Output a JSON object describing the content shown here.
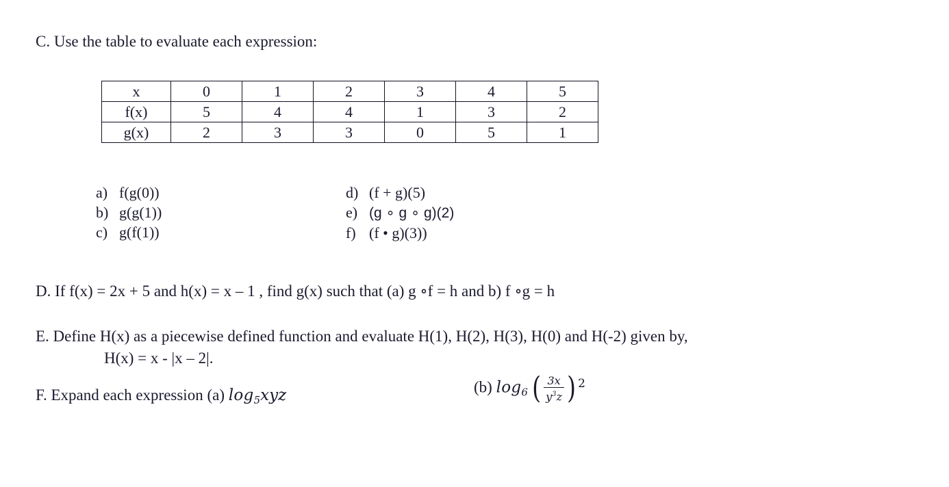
{
  "document": {
    "section_c": {
      "heading": "C. Use the table to evaluate each expression:",
      "table": {
        "row_headers": [
          "x",
          "f(x)",
          "g(x)"
        ],
        "rows": [
          {
            "label": "x",
            "values": [
              "0",
              "1",
              "2",
              "3",
              "4",
              "5"
            ]
          },
          {
            "label": "f(x)",
            "values": [
              "5",
              "4",
              "4",
              "1",
              "3",
              "2"
            ]
          },
          {
            "label": "g(x)",
            "values": [
              "2",
              "3",
              "3",
              "0",
              "5",
              "1"
            ]
          }
        ]
      },
      "expressions_left": [
        {
          "label": "a)",
          "text": "f(g(0))"
        },
        {
          "label": "b)",
          "text": "g(g(1))"
        },
        {
          "label": "c)",
          "text": "g(f(1))"
        }
      ],
      "expressions_right": [
        {
          "label": "d)",
          "text": "(f + g)(5)"
        },
        {
          "label": "e)",
          "text": "(g ∘ g ∘ g)(2)"
        },
        {
          "label": "f)",
          "text": "(f • g)(3))"
        }
      ]
    },
    "section_d": {
      "text": "D. If f(x) = 2x + 5 and h(x) = x – 1 , find g(x) such that (a) g ∘f = h   and   b) f ∘g = h"
    },
    "section_e": {
      "text": "E. Define H(x) as a piecewise defined function and evaluate H(1), H(2), H(3), H(0) and H(-2) given by,",
      "formula": "H(x) = x - |x – 2|."
    },
    "section_f": {
      "text_a": "F. Expand each expression (a) ",
      "log_a": {
        "name": "log",
        "base": "5",
        "argument": "xyz"
      },
      "label_b": "(b) ",
      "log_b": {
        "name": "log",
        "base": "6",
        "numerator": "3x",
        "denominator_base": "y",
        "denominator_exp": "3",
        "denominator_tail": "z",
        "exponent": "2"
      }
    }
  },
  "style": {
    "text_color": "#1a1a2e",
    "background": "#ffffff",
    "table_border": "#111122"
  }
}
